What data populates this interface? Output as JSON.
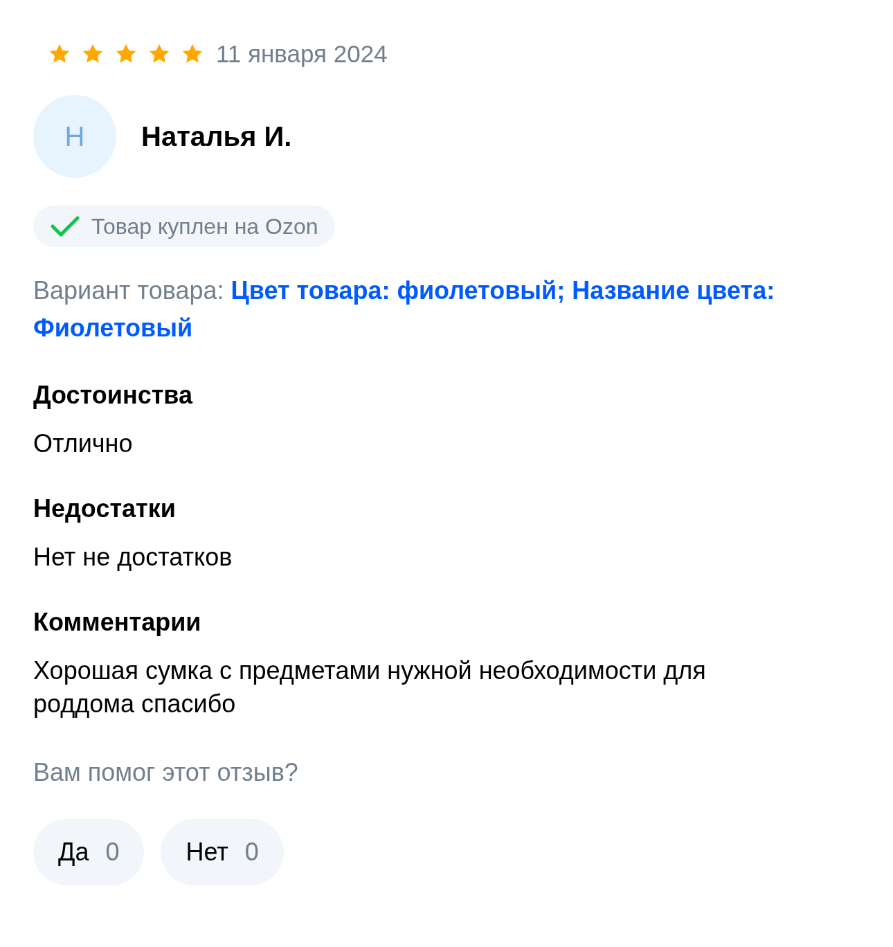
{
  "review": {
    "stars": 5,
    "date": "11 января 2024",
    "author": {
      "initial": "Н",
      "name": "Наталья И."
    },
    "badge": "Товар куплен на Ozon",
    "variant": {
      "label": "Вариант товара:",
      "value": "Цвет товара: фиолетовый; Название цвета: Фиолетовый"
    },
    "sections": [
      {
        "title": "Достоинства",
        "text": "Отлично"
      },
      {
        "title": "Недостатки",
        "text": "Нет не достатков"
      },
      {
        "title": "Комментарии",
        "text": "Хорошая сумка с предметами нужной необходимости для роддома спасибо"
      }
    ],
    "helpful": {
      "question": "Вам помог этот отзыв?",
      "buttons": [
        {
          "label": "Да",
          "count": "0"
        },
        {
          "label": "Нет",
          "count": "0"
        }
      ]
    }
  }
}
